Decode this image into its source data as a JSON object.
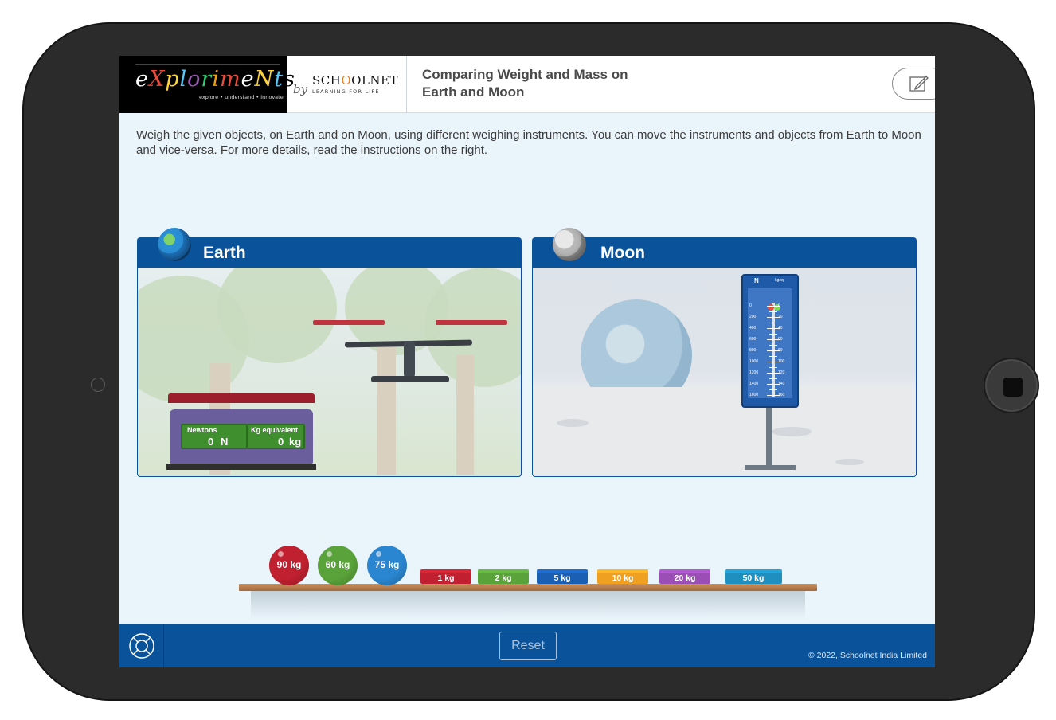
{
  "header": {
    "logo_text": "eXplorimeNts",
    "logo_tagline": "explore • understand • innovate",
    "by": "by",
    "schoolnet_name": "SCHOOLNET",
    "schoolnet_tagline": "LEARNING FOR LIFE",
    "title": "Comparing Weight and Mass on Earth and Moon",
    "notes_icon": "pencil-note-icon"
  },
  "instructions": "Weigh the given objects, on Earth and on Moon, using different weighing instruments. You can move the instruments and objects from Earth to Moon and vice-versa. For more details, read the instructions on the right.",
  "earth_panel": {
    "title": "Earth",
    "icon": "earth-globe-icon",
    "digital_scale": {
      "label_newtons": "Newtons",
      "label_kg": "Kg equivalent",
      "value_newtons": "0",
      "unit_newtons": "N",
      "value_kg": "0",
      "unit_kg": "kg"
    }
  },
  "moon_panel": {
    "title": "Moon",
    "icon": "moon-icon",
    "spring_balance": {
      "left_unit": "N",
      "right_unit": "kgeq",
      "left_ticks": [
        "0",
        "200",
        "400",
        "600",
        "800",
        "1000",
        "1200",
        "1400",
        "1600"
      ],
      "right_ticks": [
        "0",
        "20",
        "40",
        "60",
        "80",
        "100",
        "120",
        "140",
        "160"
      ]
    }
  },
  "objects": {
    "balls": [
      {
        "label": "90 kg",
        "color": "#c0202f"
      },
      {
        "label": "60 kg",
        "color": "#5aa33a"
      },
      {
        "label": "75 kg",
        "color": "#2a86d0"
      }
    ],
    "weights": [
      {
        "label": "1 kg",
        "color": "#c0202f"
      },
      {
        "label": "2 kg",
        "color": "#5aa33a"
      },
      {
        "label": "5 kg",
        "color": "#1a5fb4"
      },
      {
        "label": "10 kg",
        "color": "#f0a020"
      },
      {
        "label": "20 kg",
        "color": "#9b4fb6"
      },
      {
        "label": "50 kg",
        "color": "#1f8fc0"
      }
    ]
  },
  "footer": {
    "help_icon": "lifebuoy-icon",
    "reset_label": "Reset",
    "copyright": "© 2022, Schoolnet India Limited"
  }
}
